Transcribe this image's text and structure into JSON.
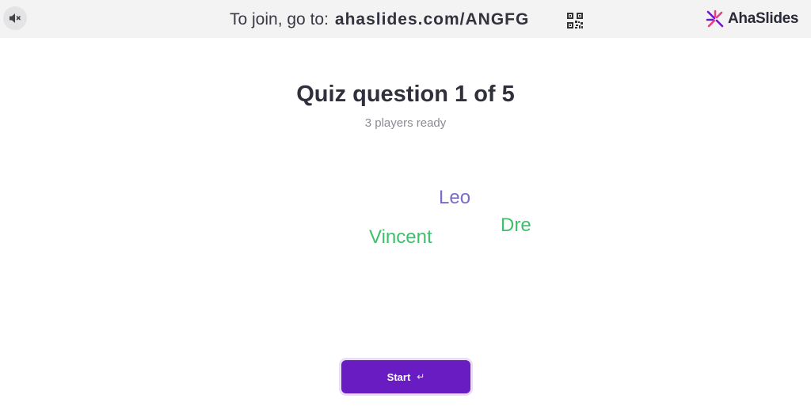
{
  "header": {
    "join_prefix": "To join, go to:",
    "join_url": "ahaslides.com/ANGFG",
    "brand_name": "AhaSlides"
  },
  "quiz": {
    "title": "Quiz question 1 of 5",
    "status": "3 players ready"
  },
  "players": [
    {
      "name": "Leo",
      "color": "#7b6bc8"
    },
    {
      "name": "Dre",
      "color": "#3fbf6b"
    },
    {
      "name": "Vincent",
      "color": "#3fbf6b"
    }
  ],
  "actions": {
    "start_label": "Start",
    "start_icon": "enter-icon"
  },
  "icons": {
    "mute": "speaker-muted-icon",
    "qr": "qr-code-icon",
    "logo": "ahaslides-logo-icon"
  },
  "colors": {
    "accent": "#6a1cc3",
    "topbar_bg": "#f3f3f4",
    "logo_pink": "#e8417f",
    "logo_purple": "#6a1cc3"
  }
}
